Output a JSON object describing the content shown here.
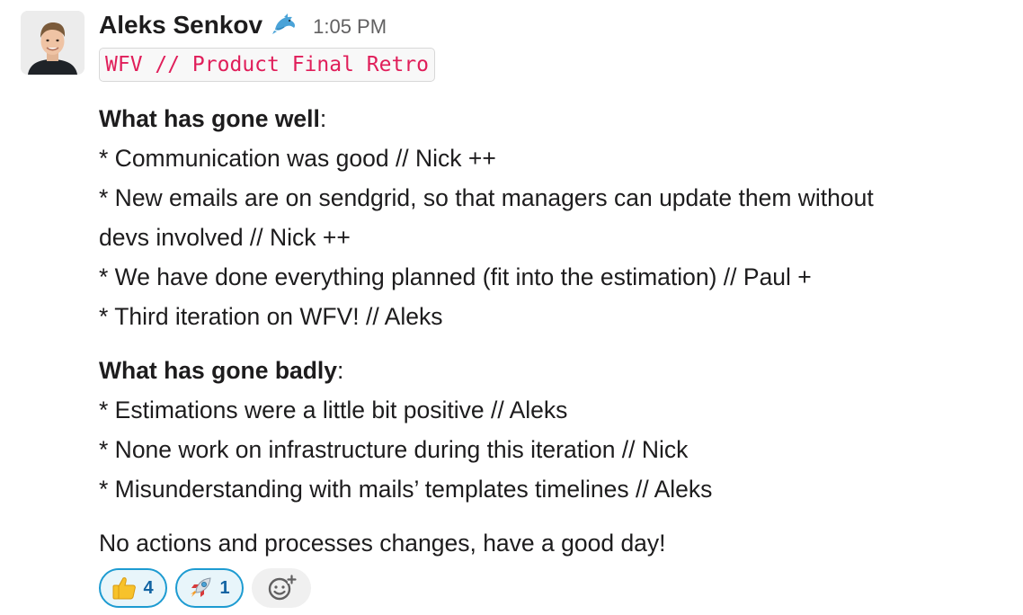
{
  "message": {
    "sender": "Aleks Senkov",
    "status_emoji": "dolphin-icon",
    "timestamp": "1:05 PM",
    "code_title": "WFV // Product Final Retro",
    "went_well": {
      "heading": "What has gone well",
      "items": [
        "* Communication was good // Nick ++",
        "* New emails are on sendgrid, so that managers can update them without",
        "devs involved // Nick ++",
        "* We have done everything planned (fit into the estimation) // Paul +",
        "* Third iteration on WFV! // Aleks"
      ]
    },
    "went_badly": {
      "heading": "What has gone badly",
      "items": [
        "* Estimations were a little bit positive // Aleks",
        "* None work on infrastructure during this iteration // Nick",
        "* Misunderstanding with mails’ templates timelines // Aleks"
      ]
    },
    "closing": "No actions and processes changes, have a good day!",
    "heading_colon": ":"
  },
  "reactions": [
    {
      "icon": "thumbs-up-icon",
      "count": "4"
    },
    {
      "icon": "rocket-icon",
      "count": "1"
    }
  ],
  "add_reaction_icon": "add-reaction-icon",
  "colors": {
    "code_text": "#e01e5a",
    "reaction_border": "#1d9bd1",
    "reaction_bg": "#e8f5fa",
    "reaction_count": "#1264a3",
    "timestamp": "#616061"
  }
}
